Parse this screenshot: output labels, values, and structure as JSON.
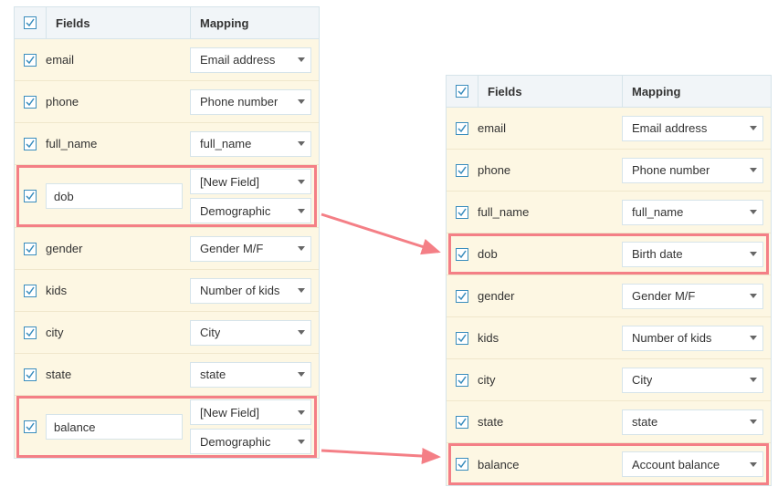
{
  "columns": {
    "fields": "Fields",
    "mapping": "Mapping"
  },
  "left": {
    "rows": [
      {
        "field": "email",
        "dd": [
          "Email address"
        ],
        "editable": false,
        "hl": false
      },
      {
        "field": "phone",
        "dd": [
          "Phone number"
        ],
        "editable": false,
        "hl": false
      },
      {
        "field": "full_name",
        "dd": [
          "full_name"
        ],
        "editable": false,
        "hl": false
      },
      {
        "field": "dob",
        "dd": [
          "[New Field]",
          "Demographic"
        ],
        "editable": true,
        "hl": true
      },
      {
        "field": "gender",
        "dd": [
          "Gender M/F"
        ],
        "editable": false,
        "hl": false
      },
      {
        "field": "kids",
        "dd": [
          "Number of kids"
        ],
        "editable": false,
        "hl": false
      },
      {
        "field": "city",
        "dd": [
          "City"
        ],
        "editable": false,
        "hl": false
      },
      {
        "field": "state",
        "dd": [
          "state"
        ],
        "editable": false,
        "hl": false
      },
      {
        "field": "balance",
        "dd": [
          "[New Field]",
          "Demographic"
        ],
        "editable": true,
        "hl": true
      }
    ]
  },
  "right": {
    "rows": [
      {
        "field": "email",
        "dd": [
          "Email address"
        ],
        "hl": false
      },
      {
        "field": "phone",
        "dd": [
          "Phone number"
        ],
        "hl": false
      },
      {
        "field": "full_name",
        "dd": [
          "full_name"
        ],
        "hl": false
      },
      {
        "field": "dob",
        "dd": [
          "Birth date"
        ],
        "hl": true
      },
      {
        "field": "gender",
        "dd": [
          "Gender M/F"
        ],
        "hl": false
      },
      {
        "field": "kids",
        "dd": [
          "Number of kids"
        ],
        "hl": false
      },
      {
        "field": "city",
        "dd": [
          "City"
        ],
        "hl": false
      },
      {
        "field": "state",
        "dd": [
          "state"
        ],
        "hl": false
      },
      {
        "field": "balance",
        "dd": [
          "Account balance"
        ],
        "hl": true
      }
    ]
  },
  "colors": {
    "arrow": "#f47f86"
  }
}
